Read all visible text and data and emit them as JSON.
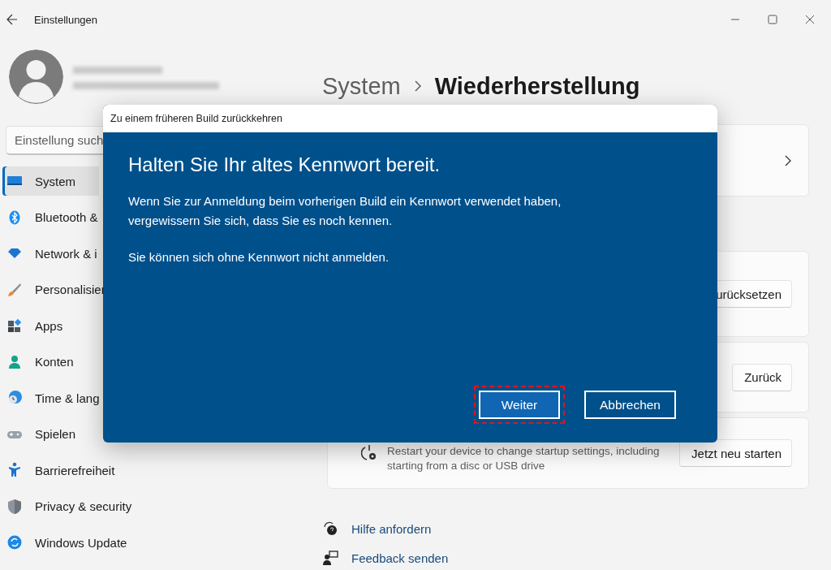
{
  "window": {
    "title": "Einstellungen"
  },
  "sidebar": {
    "search": {
      "placeholder": "Einstellung such"
    },
    "items": [
      {
        "label": "System",
        "selected": true
      },
      {
        "label": "Bluetooth &",
        "selected": false
      },
      {
        "label": "Network & i",
        "selected": false
      },
      {
        "label": "Personalisier",
        "selected": false
      },
      {
        "label": "Apps",
        "selected": false
      },
      {
        "label": "Konten",
        "selected": false
      },
      {
        "label": "Time & lang",
        "selected": false
      },
      {
        "label": "Spielen",
        "selected": false
      },
      {
        "label": "Barrierefreiheit",
        "selected": false
      },
      {
        "label": "Privacy & security",
        "selected": false
      },
      {
        "label": "Windows Update",
        "selected": false
      }
    ]
  },
  "header": {
    "breadcrumb": "System",
    "title": "Wiederherstellung"
  },
  "cards": [
    {
      "kind": "nav"
    },
    {
      "kind": "button",
      "button": "urücksetzen"
    },
    {
      "kind": "button",
      "button": "Zurück"
    },
    {
      "kind": "option",
      "description": "Restart your device to change startup settings, including starting from a disc or USB drive",
      "button": "Jetzt neu starten"
    }
  ],
  "links": [
    {
      "label": "Hilfe anfordern"
    },
    {
      "label": "Feedback senden"
    }
  ],
  "dialog": {
    "title": "Zu einem früheren Build zurückkehren",
    "heading": "Halten Sie Ihr altes Kennwort bereit.",
    "paragraphs": [
      "Wenn Sie zur Anmeldung beim vorherigen Build ein Kennwort verwendet haben, vergewissern Sie sich, dass Sie es noch kennen.",
      "Sie können sich ohne Kennwort nicht anmelden."
    ],
    "buttons": [
      {
        "label": "Weiter",
        "focused": true
      },
      {
        "label": "Abbrechen",
        "focused": false
      }
    ]
  }
}
